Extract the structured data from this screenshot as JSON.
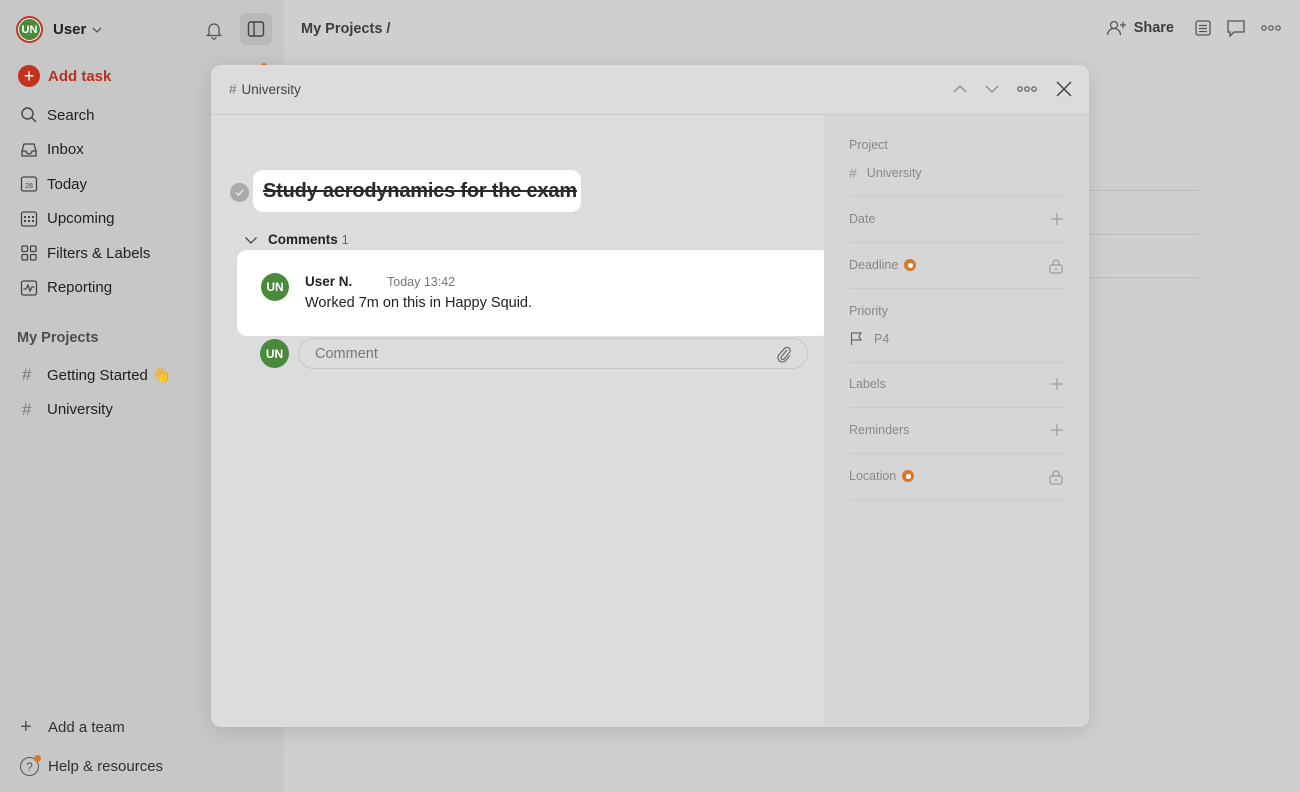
{
  "sidebar": {
    "user": {
      "initials": "UN",
      "name": "User"
    },
    "add_task_label": "Add task",
    "nav": [
      {
        "label": "Search",
        "icon": "search-icon"
      },
      {
        "label": "Inbox",
        "icon": "inbox-icon"
      },
      {
        "label": "Today",
        "icon": "calendar-today-icon",
        "day": "28"
      },
      {
        "label": "Upcoming",
        "icon": "calendar-grid-icon"
      },
      {
        "label": "Filters & Labels",
        "icon": "grid-icon"
      },
      {
        "label": "Reporting",
        "icon": "reporting-icon"
      }
    ],
    "projects_title": "My Projects",
    "projects": [
      {
        "label": "Getting Started 👋"
      },
      {
        "label": "University"
      }
    ],
    "add_team_label": "Add a team",
    "help_label": "Help & resources"
  },
  "topbar": {
    "breadcrumb": "My Projects /",
    "share_label": "Share"
  },
  "modal": {
    "project": "University",
    "task_title": "Study aerodynamics for the exam",
    "comments_label": "Comments",
    "comments_count": "1",
    "comment": {
      "initials": "UN",
      "author": "User N.",
      "time": "Today 13:42",
      "body": "Worked 7m on this in Happy Squid."
    },
    "input": {
      "initials": "UN",
      "placeholder": "Comment"
    },
    "props": {
      "project_label": "Project",
      "project_value": "University",
      "date_label": "Date",
      "deadline_label": "Deadline",
      "priority_label": "Priority",
      "priority_value": "P4",
      "labels_label": "Labels",
      "reminders_label": "Reminders",
      "location_label": "Location"
    }
  },
  "colors": {
    "accent_red": "#c3321e",
    "avatar_green": "#4a8a3c",
    "badge_orange": "#d97a2b"
  }
}
